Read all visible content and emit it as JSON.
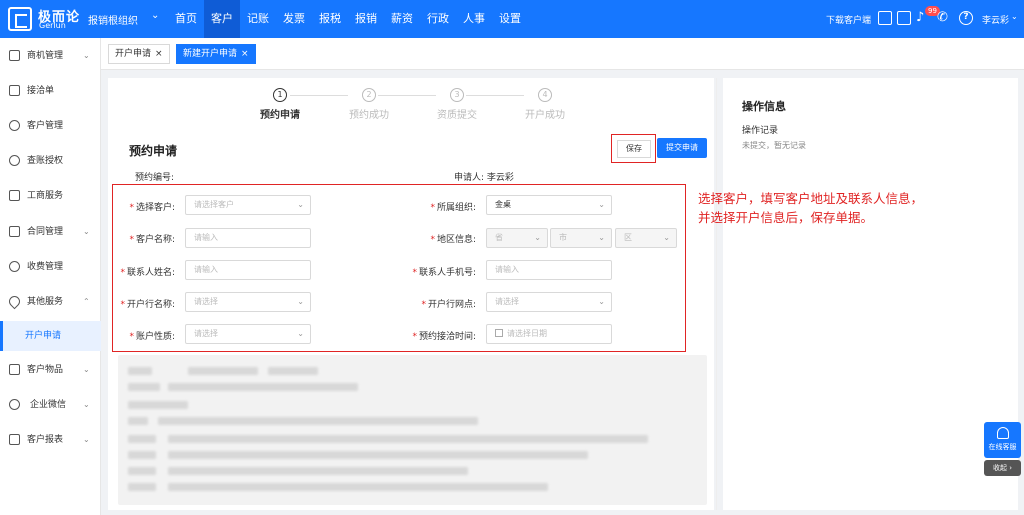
{
  "topbar": {
    "logo_cn": "极而论",
    "logo_en": "Gerlun",
    "org": "报销根组织",
    "nav": [
      "首页",
      "客户",
      "记账",
      "发票",
      "报税",
      "报销",
      "薪资",
      "行政",
      "人事",
      "设置"
    ],
    "download": "下载客户端",
    "badge": "99",
    "user": "李云彩"
  },
  "sidebar": {
    "items": [
      "商机管理",
      "接洽单",
      "客户管理",
      "查账授权",
      "工商服务",
      "合同管理",
      "收费管理",
      "其他服务",
      "开户申请",
      "客户物品",
      "企业微信",
      "客户报表"
    ]
  },
  "tabs": [
    {
      "label": "开户申请",
      "close": "×"
    },
    {
      "label": "新建开户申请",
      "close": "×"
    }
  ],
  "steps": [
    {
      "num": "1",
      "label": "预约申请"
    },
    {
      "num": "2",
      "label": "预约成功"
    },
    {
      "num": "3",
      "label": "资质提交"
    },
    {
      "num": "4",
      "label": "开户成功"
    }
  ],
  "section_title": "预约申请",
  "buttons": {
    "save": "保存",
    "submit": "提交申请"
  },
  "meta": {
    "booking_no": "预约编号:",
    "applicant": "申请人: 李云彩"
  },
  "form": {
    "customer_label": "选择客户:",
    "customer_ph": "请选择客户",
    "org_label": "所属组织:",
    "org_value": "金桌",
    "name_label": "客户名称:",
    "name_ph": "请输入",
    "region_label": "地区信息:",
    "province_ph": "省",
    "city_ph": "市",
    "district_ph": "区",
    "contact_label": "联系人姓名:",
    "contact_ph": "请输入",
    "phone_label": "联系人手机号:",
    "phone_ph": "请输入",
    "bank_label": "开户行名称:",
    "bank_ph": "请选择",
    "branch_label": "开户行网点:",
    "branch_ph": "请选择",
    "acct_label": "账户性质:",
    "acct_ph": "请选择",
    "date_label": "预约接洽时间:",
    "date_ph": "请选择日期"
  },
  "annotation": {
    "line1": "选择客户，填写客户地址及联系人信息，",
    "line2": "并选择开户信息后，保存单据。"
  },
  "right_panel": {
    "title": "操作信息",
    "log": "操作记录",
    "empty": "未提交，暂无记录"
  },
  "floating": {
    "service": "在线客服",
    "collapse": "收起 ›"
  }
}
